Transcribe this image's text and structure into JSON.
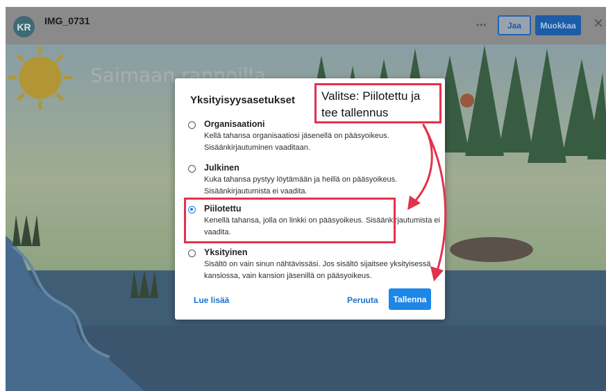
{
  "header": {
    "avatar_initials": "KR",
    "title": "IMG_0731",
    "more_label": "•••",
    "share_label": "Jaa",
    "edit_label": "Muokkaa",
    "close_label": "✕"
  },
  "background": {
    "caption": "Saimaan rannoilla"
  },
  "dialog": {
    "title": "Yksityisyysasetukset",
    "selected": "Piilotettu",
    "options": [
      {
        "label": "Organisaationi",
        "description": "Kellä tahansa organisaatiosi jäsenellä on pääsyoikeus. Sisäänkirjautuminen vaaditaan.",
        "selected": false
      },
      {
        "label": "Julkinen",
        "description": "Kuka tahansa pystyy löytämään ja heillä on pääsyoikeus. Sisäänkirjautumista ei vaadita.",
        "selected": false
      },
      {
        "label": "Piilotettu",
        "description": "Kenellä tahansa, jolla on linkki on pääsyoikeus. Sisäänkirjautumista ei vaadita.",
        "selected": true
      },
      {
        "label": "Yksityinen",
        "description": "Sisältö on vain sinun nähtävissäsi. Jos sisältö sijaitsee yksityisessä kansiossa, vain kansion jäsenillä on pääsyoikeus.",
        "selected": false
      }
    ],
    "learn_more_label": "Lue lisää",
    "cancel_label": "Peruuta",
    "save_label": "Tallenna"
  },
  "annotation": {
    "callout_text": "Valitse: Piilotettu ja tee tallennus",
    "color": "#e2324c"
  },
  "colors": {
    "accent": "#1e86e6",
    "link": "#1b73c9",
    "highlight": "#e2324c"
  }
}
